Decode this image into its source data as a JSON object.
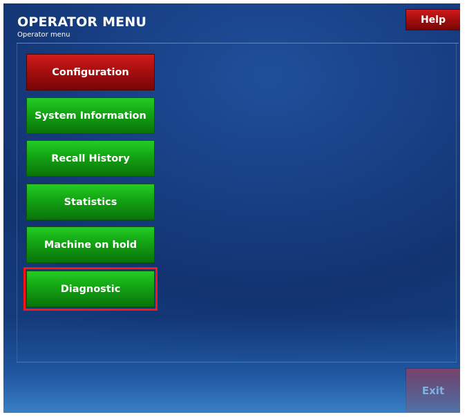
{
  "header": {
    "title": "OPERATOR MENU",
    "subtitle": "Operator menu",
    "help_label": "Help"
  },
  "menu": {
    "items": [
      {
        "label": "Configuration",
        "color": "#b01212"
      },
      {
        "label": "System Information",
        "color": "#16a316"
      },
      {
        "label": "Recall History",
        "color": "#16a316"
      },
      {
        "label": "Statistics",
        "color": "#16a316"
      },
      {
        "label": "Machine on hold",
        "color": "#16a316"
      },
      {
        "label": "Diagnostic",
        "color": "#16a316",
        "highlighted": true
      }
    ],
    "highlight_color": "#ff1414"
  },
  "footer": {
    "exit_label": "Exit"
  },
  "colors": {
    "background": "#163a7d",
    "button_red": "#b01212",
    "button_green": "#16a316"
  }
}
